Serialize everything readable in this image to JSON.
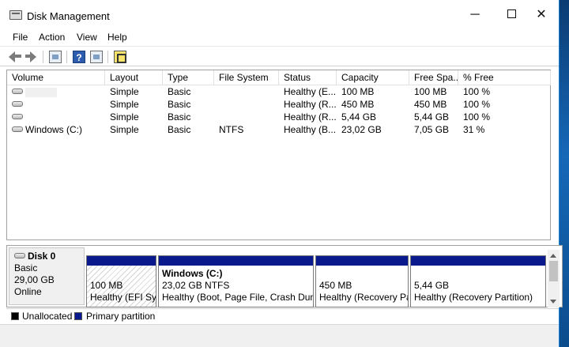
{
  "window": {
    "title": "Disk Management",
    "minimize_glyph": "─",
    "close_glyph": "✕"
  },
  "menu": [
    "File",
    "Action",
    "View",
    "Help"
  ],
  "toolbar": {
    "icons": [
      "back-icon",
      "forward-icon",
      "show-panel-icon",
      "help-icon",
      "console-view-icon",
      "properties-icon"
    ],
    "help_glyph": "?"
  },
  "volume_list": {
    "columns": [
      "Volume",
      "Layout",
      "Type",
      "File System",
      "Status",
      "Capacity",
      "Free Spa...",
      "% Free"
    ],
    "rows": [
      {
        "volume": "",
        "layout": "Simple",
        "type": "Basic",
        "fs": "",
        "status": "Healthy (E...",
        "capacity": "100 MB",
        "free": "100 MB",
        "pct": "100 %"
      },
      {
        "volume": "",
        "layout": "Simple",
        "type": "Basic",
        "fs": "",
        "status": "Healthy (R...",
        "capacity": "450 MB",
        "free": "450 MB",
        "pct": "100 %"
      },
      {
        "volume": "",
        "layout": "Simple",
        "type": "Basic",
        "fs": "",
        "status": "Healthy (R...",
        "capacity": "5,44 GB",
        "free": "5,44 GB",
        "pct": "100 %"
      },
      {
        "volume": "Windows (C:)",
        "layout": "Simple",
        "type": "Basic",
        "fs": "NTFS",
        "status": "Healthy (B...",
        "capacity": "23,02 GB",
        "free": "7,05 GB",
        "pct": "31 %"
      }
    ]
  },
  "disk": {
    "name": "Disk 0",
    "type": "Basic",
    "size": "29,00 GB",
    "state": "Online",
    "partitions": [
      {
        "title": "",
        "line1": "100 MB",
        "line2": "Healthy (EFI Sy"
      },
      {
        "title": "Windows  (C:)",
        "line1": "23,02 GB NTFS",
        "line2": "Healthy (Boot, Page File, Crash Dum"
      },
      {
        "title": "",
        "line1": "450 MB",
        "line2": "Healthy (Recovery Pa"
      },
      {
        "title": "",
        "line1": "5,44 GB",
        "line2": "Healthy (Recovery Partition)"
      }
    ]
  },
  "legend": {
    "unallocated": "Unallocated",
    "primary": "Primary partition",
    "unallocated_color": "#000000",
    "primary_color": "#0a1a8c"
  }
}
